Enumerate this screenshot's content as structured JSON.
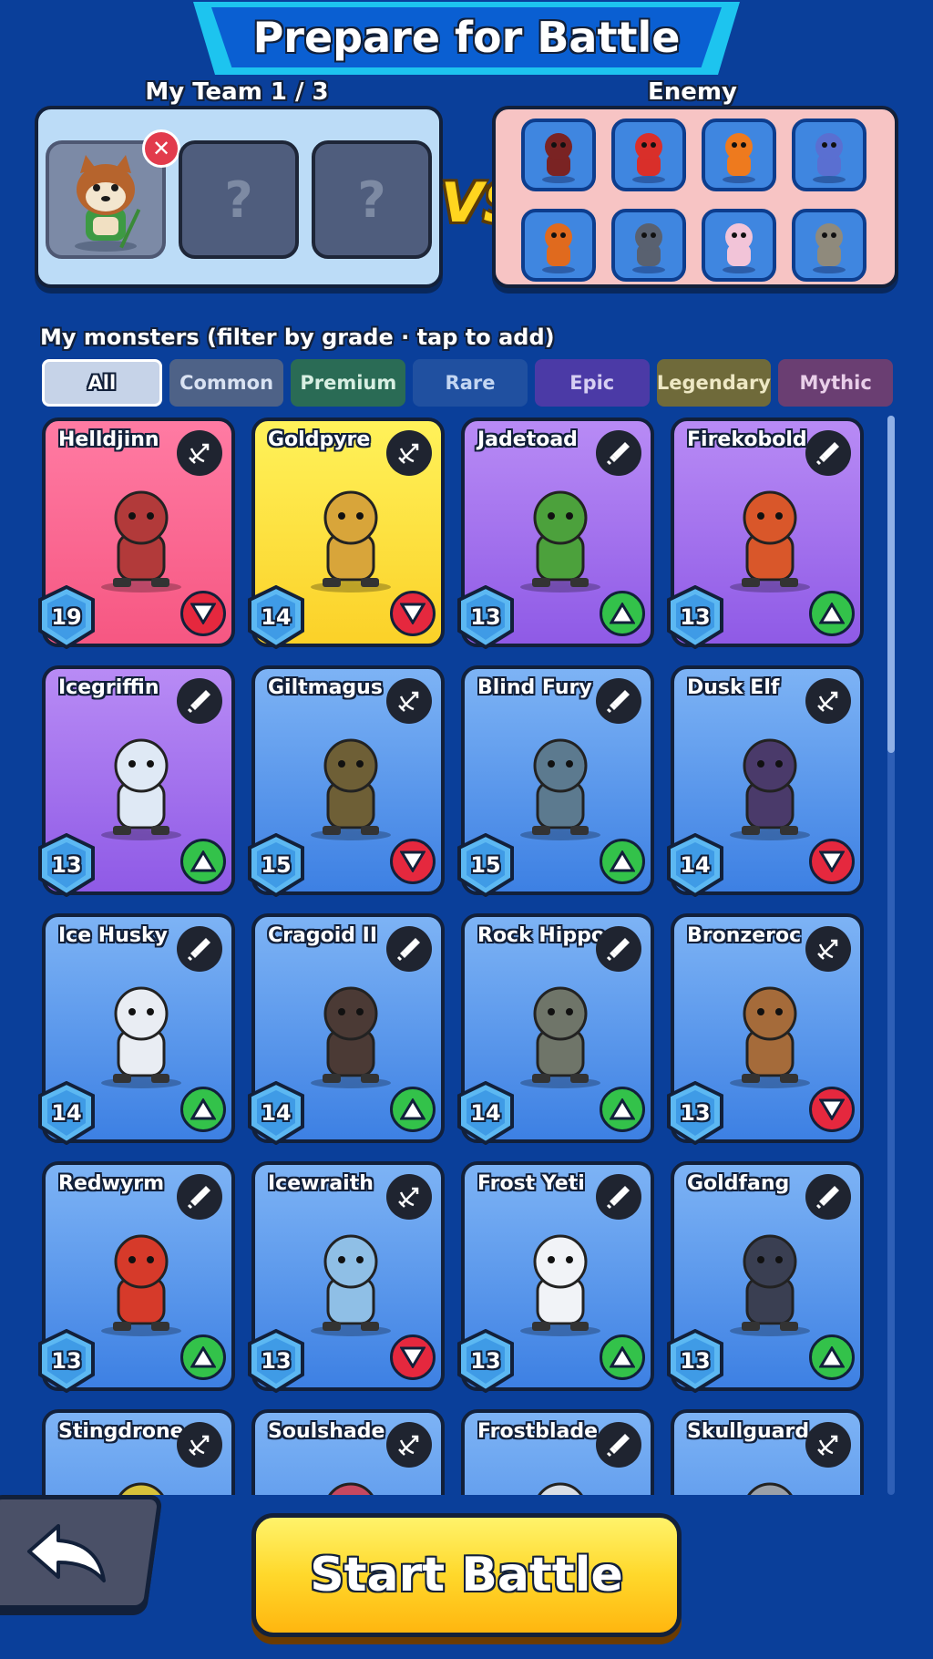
{
  "title": "Prepare for Battle",
  "team": {
    "label": "My Team  1 / 3",
    "slots": [
      {
        "state": "filled",
        "icon": "red-panda-monk"
      },
      {
        "state": "empty",
        "placeholder": "?"
      },
      {
        "state": "empty",
        "placeholder": "?"
      }
    ],
    "remove_icon": "close-icon"
  },
  "vs_label": "VS",
  "enemy": {
    "label": "Enemy",
    "icons": [
      "ninja",
      "red-dragon",
      "orange-lizard",
      "blue-fire-demon",
      "orange-spiky-warrior",
      "skull-knight",
      "white-hair-girl",
      "stone-golem"
    ]
  },
  "monsters_label": "My monsters (filter by grade · tap to add)",
  "filters": [
    {
      "label": "All",
      "selected": true,
      "bg": "#c6d3e8",
      "border": "#ffffff",
      "color": "#ffffff"
    },
    {
      "label": "Common",
      "bg": "#4e6287",
      "color": "#d9e2f2"
    },
    {
      "label": "Premium",
      "bg": "#2a6b55",
      "color": "#d8efe2"
    },
    {
      "label": "Rare",
      "bg": "#2050a0",
      "color": "#c3d6f2"
    },
    {
      "label": "Epic",
      "bg": "#4b3aa6",
      "color": "#d6cff2"
    },
    {
      "label": "Legendary",
      "bg": "#6f6a3a",
      "color": "#eee8c4"
    },
    {
      "label": "Mythic",
      "bg": "#6a3e72",
      "color": "#e9cfe9"
    }
  ],
  "monsters": [
    {
      "name": "Helldjinn",
      "level": "19",
      "trend": "down",
      "role": "ranged",
      "grade": "mythic"
    },
    {
      "name": "Goldpyre",
      "level": "14",
      "trend": "down",
      "role": "ranged",
      "grade": "legendary"
    },
    {
      "name": "Jadetoad",
      "level": "13",
      "trend": "up",
      "role": "melee",
      "grade": "epic"
    },
    {
      "name": "Firekobold",
      "level": "13",
      "trend": "up",
      "role": "melee",
      "grade": "epic"
    },
    {
      "name": "Icegriffin",
      "level": "13",
      "trend": "up",
      "role": "melee",
      "grade": "epic"
    },
    {
      "name": "Giltmagus",
      "level": "15",
      "trend": "down",
      "role": "ranged",
      "grade": "rare"
    },
    {
      "name": "Blind Fury",
      "level": "15",
      "trend": "up",
      "role": "melee",
      "grade": "rare"
    },
    {
      "name": "Dusk Elf",
      "level": "14",
      "trend": "down",
      "role": "ranged",
      "grade": "rare"
    },
    {
      "name": "Ice Husky",
      "level": "14",
      "trend": "up",
      "role": "melee",
      "grade": "rare"
    },
    {
      "name": "Cragoid II",
      "level": "14",
      "trend": "up",
      "role": "melee",
      "grade": "rare"
    },
    {
      "name": "Rock Hippo",
      "level": "14",
      "trend": "up",
      "role": "melee",
      "grade": "rare"
    },
    {
      "name": "Bronzeroc",
      "level": "13",
      "trend": "down",
      "role": "ranged",
      "grade": "rare"
    },
    {
      "name": "Redwyrm",
      "level": "13",
      "trend": "up",
      "role": "melee",
      "grade": "rare"
    },
    {
      "name": "Icewraith",
      "level": "13",
      "trend": "down",
      "role": "ranged",
      "grade": "rare"
    },
    {
      "name": "Frost Yeti",
      "level": "13",
      "trend": "up",
      "role": "melee",
      "grade": "rare"
    },
    {
      "name": "Goldfang",
      "level": "13",
      "trend": "up",
      "role": "melee",
      "grade": "rare"
    },
    {
      "name": "Stingdrone",
      "level": "",
      "trend": "",
      "role": "ranged",
      "grade": "rare"
    },
    {
      "name": "Soulshade",
      "level": "",
      "trend": "",
      "role": "ranged",
      "grade": "rare"
    },
    {
      "name": "Frostblade",
      "level": "",
      "trend": "",
      "role": "melee",
      "grade": "rare"
    },
    {
      "name": "Skullguard",
      "level": "",
      "trend": "",
      "role": "ranged",
      "grade": "rare"
    }
  ],
  "grade_colors": {
    "mythic": [
      "#ff7ba3",
      "#f65782"
    ],
    "legendary": [
      "#fff25a",
      "#fbd128"
    ],
    "epic": [
      "#b88bf5",
      "#8f5ae6"
    ],
    "rare": [
      "#7db3f5",
      "#3d80e3"
    ]
  },
  "buttons": {
    "back_icon": "back-arrow-icon",
    "start_label": "Start Battle"
  }
}
